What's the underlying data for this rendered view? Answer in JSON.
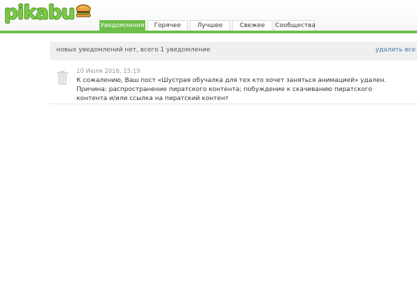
{
  "header": {
    "logo_text": "pikabu",
    "logo_icon": "burger-icon",
    "accent_color": "#6cbf4a",
    "tabs": [
      {
        "label": "Уведомления",
        "active": true
      },
      {
        "label": "Горячее",
        "active": false
      },
      {
        "label": "Лучшее",
        "active": false
      },
      {
        "label": "Свежее",
        "active": false
      },
      {
        "label": "Сообщества",
        "active": false
      }
    ]
  },
  "notice_bar": {
    "text": "новых уведомлений нет, всего 1 уведомление",
    "delete_all_label": "удалить все"
  },
  "notifications": [
    {
      "icon": "trash-icon",
      "date": "10 Июля 2016, 15:19",
      "body": "К сожалению, Ваш пост «Шустрая обучалка для тех кто хочет заняться анимацией» удален. Причина: распространение пиратского контента; побуждение к скачиванию пиратского контента и/или ссылка на пиратский контент"
    }
  ]
}
